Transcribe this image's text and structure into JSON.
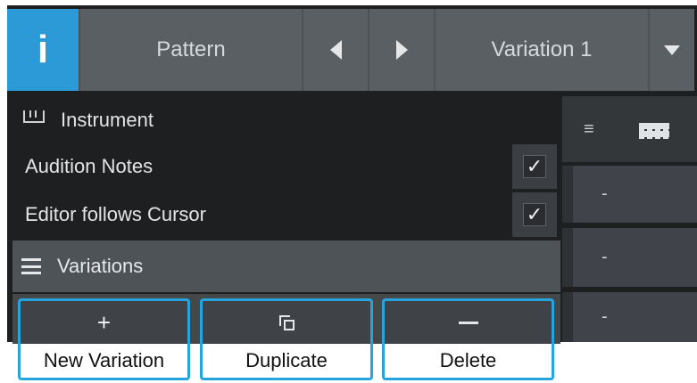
{
  "header": {
    "info_icon": "i",
    "pattern_label": "Pattern",
    "prev_icon": "triangle-left-icon",
    "next_icon": "triangle-right-icon",
    "variation_label": "Variation 1",
    "dropdown_icon": "triangle-down-icon"
  },
  "panel": {
    "instrument_label": "Instrument",
    "audition_notes_label": "Audition Notes",
    "audition_notes_checked": true,
    "editor_follows_label": "Editor follows Cursor",
    "editor_follows_checked": true,
    "check_mark": "✓",
    "variations_label": "Variations"
  },
  "right_panel": {
    "rows": [
      "-",
      "-",
      "-"
    ]
  },
  "actions": {
    "new_icon": "+",
    "new_label": "New Variation",
    "duplicate_label": "Duplicate",
    "delete_label": "Delete"
  },
  "colors": {
    "accent": "#2c9ad6",
    "highlight_border": "#25a4dd"
  }
}
